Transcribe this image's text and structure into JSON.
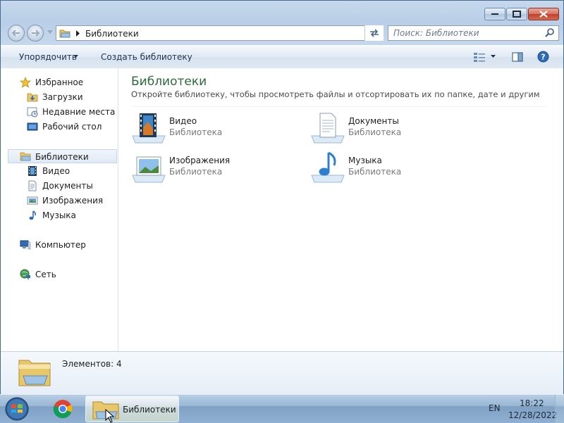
{
  "window": {
    "caption_buttons": [
      "minimize",
      "maximize",
      "close"
    ]
  },
  "address_bar": {
    "path_label": "Библиотеки"
  },
  "search": {
    "placeholder": "Поиск: Библиотеки"
  },
  "command_bar": {
    "organize_label": "Упорядочить",
    "create_library_label": "Создать библиотеку"
  },
  "nav_pane": {
    "favorites": {
      "label": "Избранное",
      "items": [
        "Загрузки",
        "Недавние места",
        "Рабочий стол"
      ]
    },
    "libraries": {
      "label": "Библиотеки",
      "items": [
        "Видео",
        "Документы",
        "Изображения",
        "Музыка"
      ]
    },
    "computer_label": "Компьютер",
    "network_label": "Сеть"
  },
  "content": {
    "title": "Библиотеки",
    "description": "Откройте библиотеку, чтобы просмотреть файлы и отсортировать их по папке, дате и другим свойств...",
    "libraries": [
      {
        "name": "Видео",
        "type": "Библиотека",
        "icon": "video-library-icon"
      },
      {
        "name": "Документы",
        "type": "Библиотека",
        "icon": "documents-library-icon"
      },
      {
        "name": "Изображения",
        "type": "Библиотека",
        "icon": "pictures-library-icon"
      },
      {
        "name": "Музыка",
        "type": "Библиотека",
        "icon": "music-library-icon"
      }
    ]
  },
  "details": {
    "item_count": "Элементов: 4"
  },
  "taskbar": {
    "explorer_label": "Библиотеки",
    "language": "EN",
    "time": "18:22",
    "date": "12/28/2022"
  },
  "colors": {
    "title_green": "#2d6a3a",
    "taskbar": "#8fb0d2",
    "close_red": "#c0402a"
  }
}
